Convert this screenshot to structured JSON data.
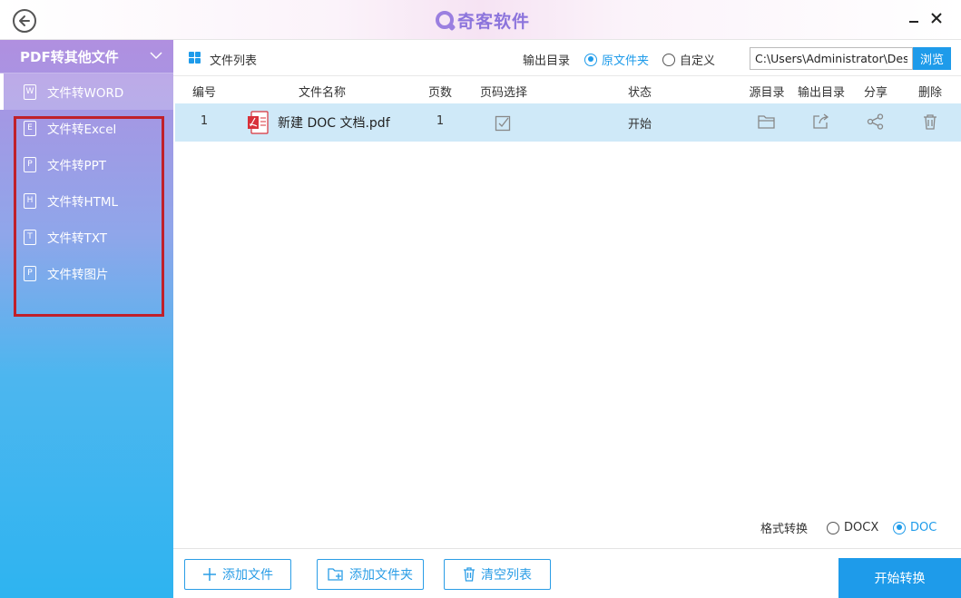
{
  "app": {
    "title": "奇客软件"
  },
  "sidebar": {
    "header": "PDF转其他文件",
    "items": [
      {
        "label": "文件转WORD",
        "icon_letter": "W",
        "active": true
      },
      {
        "label": "文件转Excel",
        "icon_letter": "E",
        "active": false
      },
      {
        "label": "文件转PPT",
        "icon_letter": "P",
        "active": false
      },
      {
        "label": "文件转HTML",
        "icon_letter": "H",
        "active": false
      },
      {
        "label": "文件转TXT",
        "icon_letter": "T",
        "active": false
      },
      {
        "label": "文件转图片",
        "icon_letter": "P",
        "active": false
      }
    ]
  },
  "toolbar": {
    "title": "文件列表",
    "output_label": "输出目录",
    "radio_original": "原文件夹",
    "radio_custom": "自定义",
    "path_value": "C:\\Users\\Administrator\\Desk",
    "browse": "浏览"
  },
  "table": {
    "headers": {
      "num": "编号",
      "name": "文件名称",
      "pages": "页数",
      "range": "页码选择",
      "status": "状态",
      "src": "源目录",
      "out": "输出目录",
      "share": "分享",
      "del": "删除"
    },
    "rows": [
      {
        "num": "1",
        "name": "新建 DOC 文档.pdf",
        "pages": "1",
        "status": "开始"
      }
    ]
  },
  "format": {
    "label": "格式转换",
    "opt_docx": "DOCX",
    "opt_doc": "DOC",
    "selected": "DOC"
  },
  "buttons": {
    "add_file": "添加文件",
    "add_folder": "添加文件夹",
    "clear": "清空列表",
    "start": "开始转换"
  },
  "colors": {
    "accent": "#1e9bea",
    "highlight": "#c0202a",
    "row": "#cfe9f8"
  },
  "icons": [
    "back-icon",
    "minimize-icon",
    "close-icon",
    "grid-icon",
    "pdf-file-icon",
    "checkbox-icon",
    "folder-icon",
    "export-icon",
    "share-icon",
    "trash-icon",
    "plus-icon",
    "folder-add-icon"
  ]
}
